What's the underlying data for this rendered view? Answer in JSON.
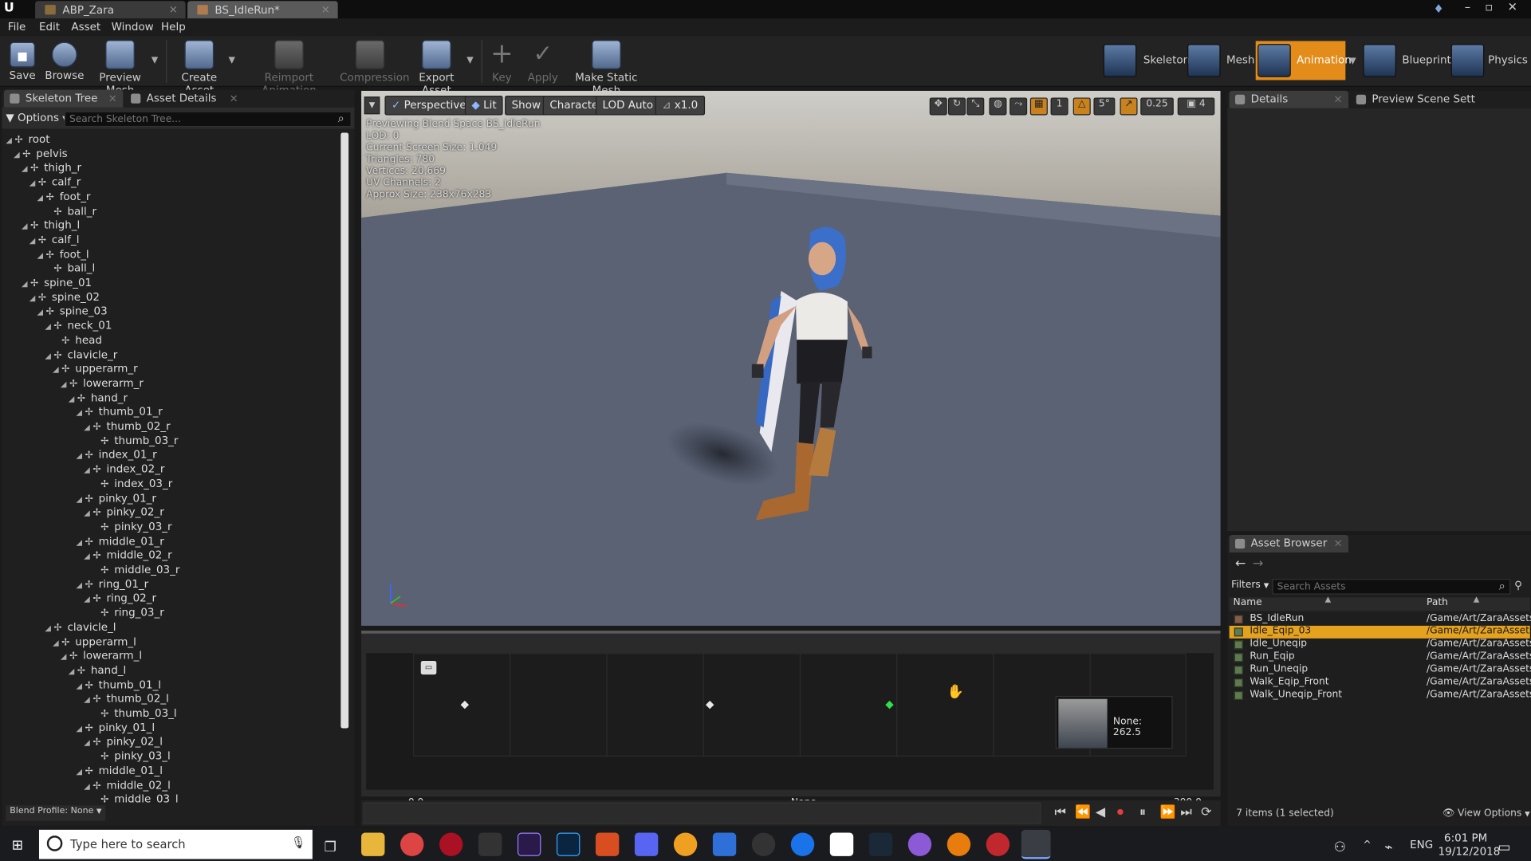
{
  "window": {
    "tabs": [
      {
        "label": "ABP_Zara",
        "active": false
      },
      {
        "label": "BS_IdleRun*",
        "active": true
      }
    ],
    "logo": "U"
  },
  "menu": {
    "items": [
      "File",
      "Edit",
      "Asset",
      "Window",
      "Help"
    ]
  },
  "toolbar": {
    "save": "Save",
    "browse": "Browse",
    "preview_mesh": "Preview Mesh",
    "create_asset": "Create Asset",
    "reimport_animation": "Reimport Animation",
    "compression": "Compression",
    "export_asset": "Export Asset",
    "key": "Key",
    "apply": "Apply",
    "make_static_mesh": "Make Static Mesh"
  },
  "modes": {
    "skeleton": "Skeleton",
    "mesh": "Mesh",
    "animation": "Animation",
    "blueprint": "Blueprint",
    "physics": "Physics",
    "selected": "Animation",
    "accent": "#e38c1a"
  },
  "skeleton_panel": {
    "tab1": "Skeleton Tree",
    "tab2": "Asset Details",
    "options": "Options",
    "search_placeholder": "Search Skeleton Tree...",
    "blend_profile": "Blend Profile: None",
    "bones": [
      {
        "name": "root",
        "depth": 0
      },
      {
        "name": "pelvis",
        "depth": 1
      },
      {
        "name": "thigh_r",
        "depth": 2
      },
      {
        "name": "calf_r",
        "depth": 3
      },
      {
        "name": "foot_r",
        "depth": 4
      },
      {
        "name": "ball_r",
        "depth": 5
      },
      {
        "name": "thigh_l",
        "depth": 2
      },
      {
        "name": "calf_l",
        "depth": 3
      },
      {
        "name": "foot_l",
        "depth": 4
      },
      {
        "name": "ball_l",
        "depth": 5
      },
      {
        "name": "spine_01",
        "depth": 2
      },
      {
        "name": "spine_02",
        "depth": 3
      },
      {
        "name": "spine_03",
        "depth": 4
      },
      {
        "name": "neck_01",
        "depth": 5
      },
      {
        "name": "head",
        "depth": 6
      },
      {
        "name": "clavicle_r",
        "depth": 5
      },
      {
        "name": "upperarm_r",
        "depth": 6
      },
      {
        "name": "lowerarm_r",
        "depth": 7
      },
      {
        "name": "hand_r",
        "depth": 8
      },
      {
        "name": "thumb_01_r",
        "depth": 9
      },
      {
        "name": "thumb_02_r",
        "depth": 10
      },
      {
        "name": "thumb_03_r",
        "depth": 11
      },
      {
        "name": "index_01_r",
        "depth": 9
      },
      {
        "name": "index_02_r",
        "depth": 10
      },
      {
        "name": "index_03_r",
        "depth": 11
      },
      {
        "name": "pinky_01_r",
        "depth": 9
      },
      {
        "name": "pinky_02_r",
        "depth": 10
      },
      {
        "name": "pinky_03_r",
        "depth": 11
      },
      {
        "name": "middle_01_r",
        "depth": 9
      },
      {
        "name": "middle_02_r",
        "depth": 10
      },
      {
        "name": "middle_03_r",
        "depth": 11
      },
      {
        "name": "ring_01_r",
        "depth": 9
      },
      {
        "name": "ring_02_r",
        "depth": 10
      },
      {
        "name": "ring_03_r",
        "depth": 11
      },
      {
        "name": "clavicle_l",
        "depth": 5
      },
      {
        "name": "upperarm_l",
        "depth": 6
      },
      {
        "name": "lowerarm_l",
        "depth": 7
      },
      {
        "name": "hand_l",
        "depth": 8
      },
      {
        "name": "thumb_01_l",
        "depth": 9
      },
      {
        "name": "thumb_02_l",
        "depth": 10
      },
      {
        "name": "thumb_03_l",
        "depth": 11
      },
      {
        "name": "pinky_01_l",
        "depth": 9
      },
      {
        "name": "pinky_02_l",
        "depth": 10
      },
      {
        "name": "pinky_03_l",
        "depth": 11
      },
      {
        "name": "middle_01_l",
        "depth": 9
      },
      {
        "name": "middle_02_l",
        "depth": 10
      },
      {
        "name": "middle_03_l",
        "depth": 11
      }
    ]
  },
  "viewport": {
    "perspective": "Perspective",
    "lit": "Lit",
    "show": "Show",
    "character": "Character",
    "lod": "LOD Auto",
    "speed": "x1.0",
    "grid_snap": "1",
    "rot_snap": "5°",
    "scale_snap": "0.25",
    "cam_speed": "4",
    "stats": [
      "Previewing Blend Space BS_IdleRun",
      "LOD: 0",
      "Current Screen Size: 1.049",
      "Triangles: 780",
      "Vertices: 20,669",
      "UV Channels: 2",
      "Approx Size: 238x76x283"
    ]
  },
  "blend_space": {
    "axis_min": "0.0",
    "axis_label": "None",
    "axis_max": "300.0",
    "samples": [
      20,
      115
    ],
    "preview_point": 185,
    "tooltip": "None: 262.5"
  },
  "details_panel": {
    "tab1": "Details",
    "tab2": "Preview Scene Sett"
  },
  "asset_browser": {
    "tab": "Asset Browser",
    "filters": "Filters",
    "search_placeholder": "Search Assets",
    "col_name": "Name",
    "col_path": "Path",
    "items": [
      {
        "name": "BS_IdleRun",
        "path": "/Game/Art/ZaraAssets"
      },
      {
        "name": "Idle_Eqip_03",
        "path": "/Game/Art/ZaraAssets"
      },
      {
        "name": "Idle_Uneqip",
        "path": "/Game/Art/ZaraAssets"
      },
      {
        "name": "Run_Eqip",
        "path": "/Game/Art/ZaraAssets"
      },
      {
        "name": "Run_Uneqip",
        "path": "/Game/Art/ZaraAssets"
      },
      {
        "name": "Walk_Eqip_Front",
        "path": "/Game/Art/ZaraAssets"
      },
      {
        "name": "Walk_Uneqip_Front",
        "path": "/Game/Art/ZaraAssets"
      }
    ],
    "selected_index": 1,
    "count": "7 items (1 selected)",
    "view_options": "View Options"
  },
  "taskbar": {
    "search_placeholder": "Type here to search",
    "lang": "ENG",
    "time": "6:01 PM",
    "date": "19/12/2018"
  }
}
